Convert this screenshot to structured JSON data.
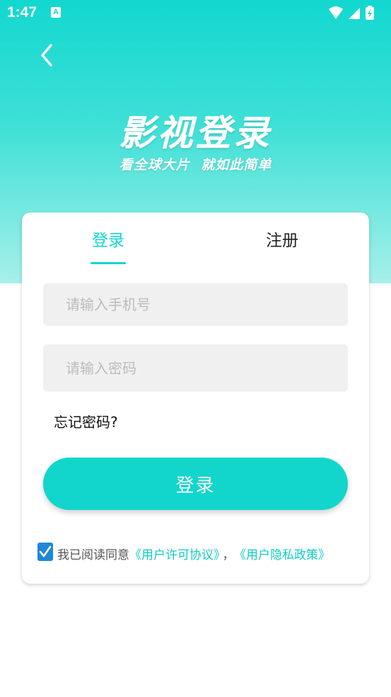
{
  "status_bar": {
    "time": "1:47",
    "notification_glyph": "A"
  },
  "header": {
    "back_icon": "chevron-left-icon",
    "title": "影视登录",
    "subtitle": "看全球大片 就如此简单"
  },
  "tabs": [
    {
      "label": "登录",
      "active": true
    },
    {
      "label": "注册",
      "active": false
    }
  ],
  "form": {
    "phone_placeholder": "请输入手机号",
    "password_placeholder": "请输入密码",
    "forgot_password": "忘记密码?",
    "login_button": "登录"
  },
  "agreement": {
    "checked": true,
    "prefix": "我已阅读同意",
    "user_agreement": "《用户许可协议》",
    "separator": "，",
    "privacy_policy": "《用户隐私政策》"
  },
  "colors": {
    "accent": "#12d6cc",
    "checkbox": "#1e88d6",
    "input_bg": "#f0f0f0"
  }
}
